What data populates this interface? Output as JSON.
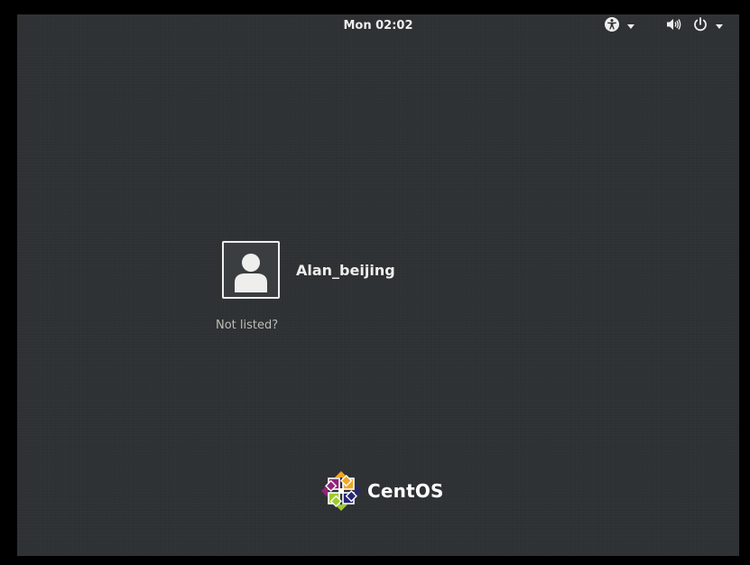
{
  "topbar": {
    "clock": "Mon 02:02",
    "icons": {
      "accessibility": "accessibility-icon",
      "volume": "volume-icon",
      "power": "power-icon"
    }
  },
  "login": {
    "users": [
      {
        "name": "Alan_beijing",
        "avatar": "user-avatar-icon"
      }
    ],
    "not_listed_label": "Not listed?"
  },
  "branding": {
    "logo": "centos-logo",
    "name": "CentOS"
  },
  "colors": {
    "background": "#2e3133",
    "foreground": "#eeeeec",
    "muted_text": "#babdb6",
    "frame": "#000000"
  }
}
